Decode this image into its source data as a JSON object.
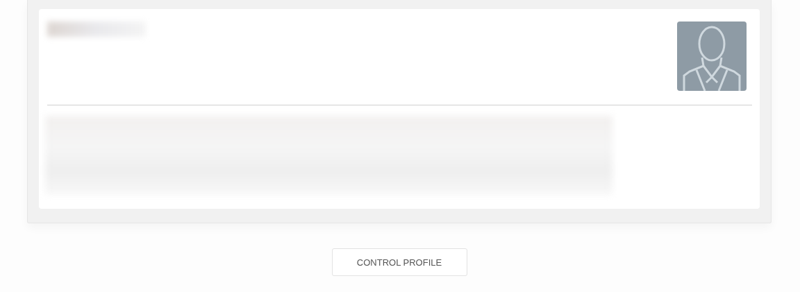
{
  "profile_card": {
    "avatar": {
      "kind": "silhouette"
    }
  },
  "button": {
    "label": "CONTROL PROFILE"
  }
}
